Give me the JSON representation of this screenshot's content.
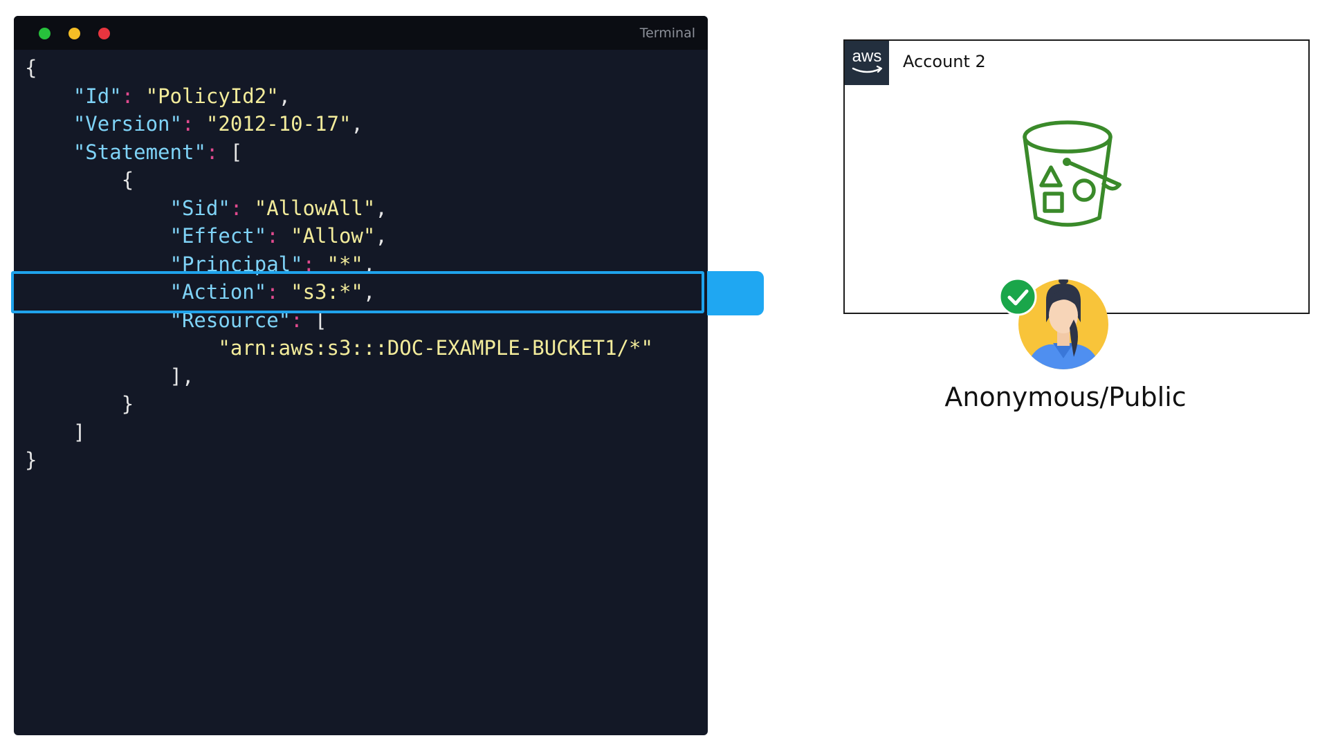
{
  "terminal": {
    "title": "Terminal",
    "code": {
      "open_brace": "{",
      "id_key": "\"Id\"",
      "id_value": "\"PolicyId2\"",
      "version_key": "\"Version\"",
      "version_value": "\"2012-10-17\"",
      "statement_key": "\"Statement\"",
      "stmt_open": "[",
      "obj_open": "{",
      "sid_key": "\"Sid\"",
      "sid_value": "\"AllowAll\"",
      "effect_key": "\"Effect\"",
      "effect_value": "\"Allow\"",
      "principal_key": "\"Principal\"",
      "principal_value": "\"*\"",
      "action_key": "\"Action\"",
      "action_value": "\"s3:*\"",
      "resource_key": "\"Resource\"",
      "resource_open": "[",
      "resource_value": "\"arn:aws:s3:::DOC-EXAMPLE-BUCKET1/*\"",
      "resource_close": "],",
      "obj_close": "}",
      "stmt_close": "]",
      "close_brace": "}"
    }
  },
  "account": {
    "logo_text": "aws",
    "title": "Account 2",
    "bucket_icon": "s3-bucket-icon",
    "bucket_color": "#3a8a2a"
  },
  "user": {
    "avatar_icon": "user-avatar-icon",
    "check_icon": "check-icon",
    "check_color": "#1aa64a",
    "label": "Anonymous/Public"
  },
  "highlight_color": "#1fa3ec"
}
